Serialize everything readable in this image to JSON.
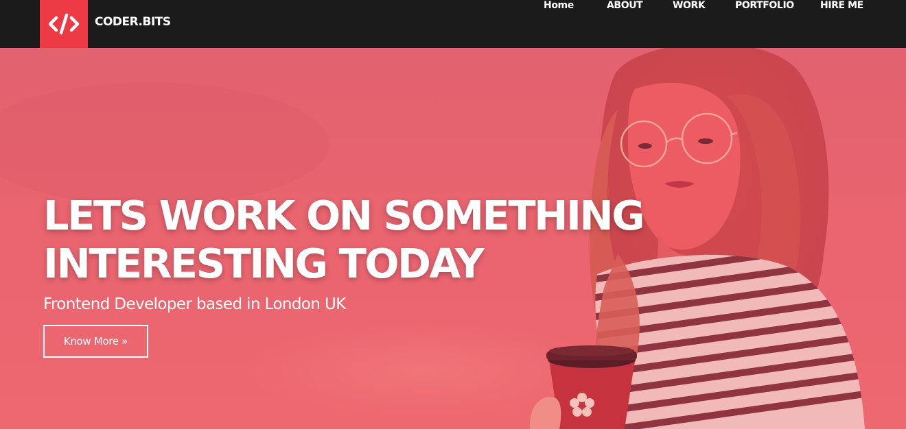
{
  "brand": {
    "name": "CODER.BITS",
    "logo_icon": "code-icon",
    "accent": "#ee3a44"
  },
  "nav": {
    "items": [
      {
        "label": "Home"
      },
      {
        "label": "ABOUT"
      },
      {
        "label": "WORK"
      },
      {
        "label": "PORTFOLIO"
      },
      {
        "label": "HIRE ME"
      }
    ]
  },
  "hero": {
    "headline_line1": "LETS WORK ON SOMETHING",
    "headline_line2": "INTERESTING TODAY",
    "subtitle": "Frontend Developer based in London UK",
    "cta_label": "Know More »",
    "overlay_color": "#e8616e"
  }
}
